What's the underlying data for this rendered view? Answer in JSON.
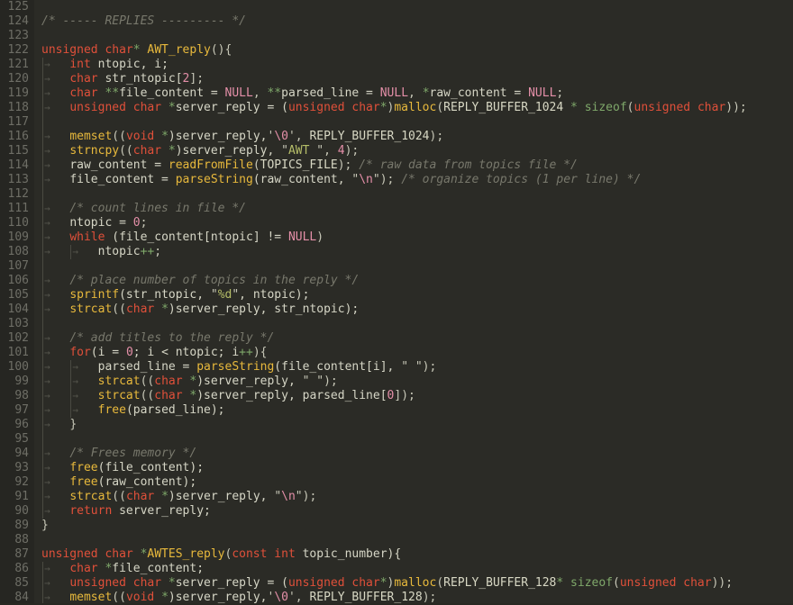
{
  "editor": {
    "name": "code-editor",
    "language": "C",
    "theme": {
      "background": "#2b2b26",
      "gutter_background": "#262622",
      "line_number_color": "#6e6e66",
      "default_text": "#d6d6c6",
      "keyword": "#e0503a",
      "function": "#e8b93c",
      "comment": "#78786c",
      "string": "#b5bd68",
      "number": "#e48fa8",
      "operator": "#7fa86a",
      "indent_guide": "#4a4a42"
    },
    "line_numbering": "relative-descending",
    "first_line_number": "125",
    "last_line_number": "84",
    "total_visible_lines": 42
  },
  "lines": [
    {
      "n": "125",
      "indent": 0,
      "tokens": []
    },
    {
      "n": "124",
      "indent": 0,
      "tokens": [
        {
          "t": "/* ----- REPLIES --------- */",
          "c": "cmt"
        }
      ]
    },
    {
      "n": "123",
      "indent": 0,
      "tokens": []
    },
    {
      "n": "122",
      "indent": 0,
      "tokens": [
        {
          "t": "unsigned char",
          "c": "kw"
        },
        {
          "t": "*",
          "c": "op"
        },
        {
          "t": " ",
          "c": "pun"
        },
        {
          "t": "AWT_reply",
          "c": "fn"
        },
        {
          "t": "(){",
          "c": "pun"
        }
      ]
    },
    {
      "n": "121",
      "indent": 1,
      "tokens": [
        {
          "t": "int",
          "c": "kw"
        },
        {
          "t": " ntopic, i;",
          "c": "id"
        }
      ]
    },
    {
      "n": "120",
      "indent": 1,
      "tokens": [
        {
          "t": "char",
          "c": "kw"
        },
        {
          "t": " str_ntopic[",
          "c": "id"
        },
        {
          "t": "2",
          "c": "num"
        },
        {
          "t": "];",
          "c": "pun"
        }
      ]
    },
    {
      "n": "119",
      "indent": 1,
      "tokens": [
        {
          "t": "char",
          "c": "kw"
        },
        {
          "t": " ",
          "c": "id"
        },
        {
          "t": "**",
          "c": "op"
        },
        {
          "t": "file_content = ",
          "c": "id"
        },
        {
          "t": "NULL",
          "c": "num"
        },
        {
          "t": ", ",
          "c": "pun"
        },
        {
          "t": "**",
          "c": "op"
        },
        {
          "t": "parsed_line = ",
          "c": "id"
        },
        {
          "t": "NULL",
          "c": "num"
        },
        {
          "t": ", ",
          "c": "pun"
        },
        {
          "t": "*",
          "c": "op"
        },
        {
          "t": "raw_content = ",
          "c": "id"
        },
        {
          "t": "NULL",
          "c": "num"
        },
        {
          "t": ";",
          "c": "pun"
        }
      ]
    },
    {
      "n": "118",
      "indent": 1,
      "tokens": [
        {
          "t": "unsigned char",
          "c": "kw"
        },
        {
          "t": " ",
          "c": "id"
        },
        {
          "t": "*",
          "c": "op"
        },
        {
          "t": "server_reply = (",
          "c": "id"
        },
        {
          "t": "unsigned char",
          "c": "kw"
        },
        {
          "t": "*",
          "c": "op"
        },
        {
          "t": ")",
          "c": "pun"
        },
        {
          "t": "malloc",
          "c": "fn"
        },
        {
          "t": "(",
          "c": "pun"
        },
        {
          "t": "REPLY_BUFFER_1024",
          "c": "cst"
        },
        {
          "t": " ",
          "c": "pun"
        },
        {
          "t": "*",
          "c": "op"
        },
        {
          "t": " ",
          "c": "pun"
        },
        {
          "t": "sizeof",
          "c": "op"
        },
        {
          "t": "(",
          "c": "pun"
        },
        {
          "t": "unsigned char",
          "c": "kw"
        },
        {
          "t": "));",
          "c": "pun"
        }
      ]
    },
    {
      "n": "117",
      "indent": 0,
      "tokens": []
    },
    {
      "n": "116",
      "indent": 1,
      "tokens": [
        {
          "t": "memset",
          "c": "fn"
        },
        {
          "t": "((",
          "c": "pun"
        },
        {
          "t": "void",
          "c": "kw"
        },
        {
          "t": " ",
          "c": "id"
        },
        {
          "t": "*",
          "c": "op"
        },
        {
          "t": ")server_reply,",
          "c": "id"
        },
        {
          "t": "'",
          "c": "pun"
        },
        {
          "t": "\\0",
          "c": "num"
        },
        {
          "t": "'",
          "c": "pun"
        },
        {
          "t": ", ",
          "c": "pun"
        },
        {
          "t": "REPLY_BUFFER_1024",
          "c": "cst"
        },
        {
          "t": ");",
          "c": "pun"
        }
      ]
    },
    {
      "n": "115",
      "indent": 1,
      "tokens": [
        {
          "t": "strncpy",
          "c": "fn"
        },
        {
          "t": "((",
          "c": "pun"
        },
        {
          "t": "char",
          "c": "kw"
        },
        {
          "t": " ",
          "c": "id"
        },
        {
          "t": "*",
          "c": "op"
        },
        {
          "t": ")server_reply, ",
          "c": "id"
        },
        {
          "t": "\"",
          "c": "pun"
        },
        {
          "t": "AWT ",
          "c": "str"
        },
        {
          "t": "\"",
          "c": "pun"
        },
        {
          "t": ", ",
          "c": "pun"
        },
        {
          "t": "4",
          "c": "num"
        },
        {
          "t": ");",
          "c": "pun"
        }
      ]
    },
    {
      "n": "114",
      "indent": 1,
      "tokens": [
        {
          "t": "raw_content = ",
          "c": "id"
        },
        {
          "t": "readFromFile",
          "c": "fn"
        },
        {
          "t": "(",
          "c": "pun"
        },
        {
          "t": "TOPICS_FILE",
          "c": "cst"
        },
        {
          "t": "); ",
          "c": "pun"
        },
        {
          "t": "/* raw data from topics file */",
          "c": "cmt"
        }
      ]
    },
    {
      "n": "113",
      "indent": 1,
      "tokens": [
        {
          "t": "file_content = ",
          "c": "id"
        },
        {
          "t": "parseString",
          "c": "fn"
        },
        {
          "t": "(raw_content, ",
          "c": "id"
        },
        {
          "t": "\"",
          "c": "pun"
        },
        {
          "t": "\\n",
          "c": "num"
        },
        {
          "t": "\"",
          "c": "pun"
        },
        {
          "t": "); ",
          "c": "pun"
        },
        {
          "t": "/* organize topics (1 per line) */",
          "c": "cmt"
        }
      ]
    },
    {
      "n": "112",
      "indent": 0,
      "tokens": []
    },
    {
      "n": "111",
      "indent": 1,
      "tokens": [
        {
          "t": "/* count lines in file */",
          "c": "cmt"
        }
      ]
    },
    {
      "n": "110",
      "indent": 1,
      "tokens": [
        {
          "t": "ntopic = ",
          "c": "id"
        },
        {
          "t": "0",
          "c": "num"
        },
        {
          "t": ";",
          "c": "pun"
        }
      ]
    },
    {
      "n": "109",
      "indent": 1,
      "tokens": [
        {
          "t": "while",
          "c": "kw"
        },
        {
          "t": " (file_content[ntopic] != ",
          "c": "id"
        },
        {
          "t": "NULL",
          "c": "num"
        },
        {
          "t": ")",
          "c": "pun"
        }
      ]
    },
    {
      "n": "108",
      "indent": 2,
      "tokens": [
        {
          "t": "ntopic",
          "c": "id"
        },
        {
          "t": "++",
          "c": "op"
        },
        {
          "t": ";",
          "c": "pun"
        }
      ]
    },
    {
      "n": "107",
      "indent": 0,
      "tokens": []
    },
    {
      "n": "106",
      "indent": 1,
      "tokens": [
        {
          "t": "/* place number of topics in the reply */",
          "c": "cmt"
        }
      ]
    },
    {
      "n": "105",
      "indent": 1,
      "tokens": [
        {
          "t": "sprintf",
          "c": "fn"
        },
        {
          "t": "(str_ntopic, ",
          "c": "id"
        },
        {
          "t": "\"",
          "c": "pun"
        },
        {
          "t": "%d",
          "c": "str"
        },
        {
          "t": "\"",
          "c": "pun"
        },
        {
          "t": ", ntopic);",
          "c": "id"
        }
      ]
    },
    {
      "n": "104",
      "indent": 1,
      "tokens": [
        {
          "t": "strcat",
          "c": "fn"
        },
        {
          "t": "((",
          "c": "pun"
        },
        {
          "t": "char",
          "c": "kw"
        },
        {
          "t": " ",
          "c": "id"
        },
        {
          "t": "*",
          "c": "op"
        },
        {
          "t": ")server_reply, str_ntopic);",
          "c": "id"
        }
      ]
    },
    {
      "n": "103",
      "indent": 0,
      "tokens": []
    },
    {
      "n": "102",
      "indent": 1,
      "tokens": [
        {
          "t": "/* add titles to the reply */",
          "c": "cmt"
        }
      ]
    },
    {
      "n": "101",
      "indent": 1,
      "tokens": [
        {
          "t": "for",
          "c": "kw"
        },
        {
          "t": "(i = ",
          "c": "id"
        },
        {
          "t": "0",
          "c": "num"
        },
        {
          "t": "; i < ntopic; i",
          "c": "id"
        },
        {
          "t": "++",
          "c": "op"
        },
        {
          "t": "){",
          "c": "pun"
        }
      ]
    },
    {
      "n": "100",
      "indent": 2,
      "tokens": [
        {
          "t": "parsed_line = ",
          "c": "id"
        },
        {
          "t": "parseString",
          "c": "fn"
        },
        {
          "t": "(file_content[i], ",
          "c": "id"
        },
        {
          "t": "\"",
          "c": "pun"
        },
        {
          "t": " ",
          "c": "str"
        },
        {
          "t": "\"",
          "c": "pun"
        },
        {
          "t": ");",
          "c": "pun"
        }
      ]
    },
    {
      "n": "99",
      "indent": 2,
      "tokens": [
        {
          "t": "strcat",
          "c": "fn"
        },
        {
          "t": "((",
          "c": "pun"
        },
        {
          "t": "char",
          "c": "kw"
        },
        {
          "t": " ",
          "c": "id"
        },
        {
          "t": "*",
          "c": "op"
        },
        {
          "t": ")server_reply, ",
          "c": "id"
        },
        {
          "t": "\"",
          "c": "pun"
        },
        {
          "t": " ",
          "c": "str"
        },
        {
          "t": "\"",
          "c": "pun"
        },
        {
          "t": ");",
          "c": "pun"
        }
      ]
    },
    {
      "n": "98",
      "indent": 2,
      "tokens": [
        {
          "t": "strcat",
          "c": "fn"
        },
        {
          "t": "((",
          "c": "pun"
        },
        {
          "t": "char",
          "c": "kw"
        },
        {
          "t": " ",
          "c": "id"
        },
        {
          "t": "*",
          "c": "op"
        },
        {
          "t": ")server_reply, parsed_line[",
          "c": "id"
        },
        {
          "t": "0",
          "c": "num"
        },
        {
          "t": "]);",
          "c": "pun"
        }
      ]
    },
    {
      "n": "97",
      "indent": 2,
      "tokens": [
        {
          "t": "free",
          "c": "fn"
        },
        {
          "t": "(parsed_line);",
          "c": "id"
        }
      ]
    },
    {
      "n": "96",
      "indent": 1,
      "tokens": [
        {
          "t": "}",
          "c": "pun"
        }
      ]
    },
    {
      "n": "95",
      "indent": 0,
      "tokens": []
    },
    {
      "n": "94",
      "indent": 1,
      "tokens": [
        {
          "t": "/* Frees memory */",
          "c": "cmt"
        }
      ]
    },
    {
      "n": "93",
      "indent": 1,
      "tokens": [
        {
          "t": "free",
          "c": "fn"
        },
        {
          "t": "(file_content);",
          "c": "id"
        }
      ]
    },
    {
      "n": "92",
      "indent": 1,
      "tokens": [
        {
          "t": "free",
          "c": "fn"
        },
        {
          "t": "(raw_content);",
          "c": "id"
        }
      ]
    },
    {
      "n": "91",
      "indent": 1,
      "tokens": [
        {
          "t": "strcat",
          "c": "fn"
        },
        {
          "t": "((",
          "c": "pun"
        },
        {
          "t": "char",
          "c": "kw"
        },
        {
          "t": " ",
          "c": "id"
        },
        {
          "t": "*",
          "c": "op"
        },
        {
          "t": ")server_reply, ",
          "c": "id"
        },
        {
          "t": "\"",
          "c": "pun"
        },
        {
          "t": "\\n",
          "c": "num"
        },
        {
          "t": "\"",
          "c": "pun"
        },
        {
          "t": ");",
          "c": "pun"
        }
      ]
    },
    {
      "n": "90",
      "indent": 1,
      "tokens": [
        {
          "t": "return",
          "c": "kw"
        },
        {
          "t": " server_reply;",
          "c": "id"
        }
      ]
    },
    {
      "n": "89",
      "indent": 0,
      "tokens": [
        {
          "t": "}",
          "c": "pun"
        }
      ]
    },
    {
      "n": "88",
      "indent": 0,
      "tokens": []
    },
    {
      "n": "87",
      "indent": 0,
      "tokens": [
        {
          "t": "unsigned char",
          "c": "kw"
        },
        {
          "t": " ",
          "c": "id"
        },
        {
          "t": "*",
          "c": "op"
        },
        {
          "t": "AWTES_reply",
          "c": "fn"
        },
        {
          "t": "(",
          "c": "pun"
        },
        {
          "t": "const",
          "c": "kw"
        },
        {
          "t": " ",
          "c": "id"
        },
        {
          "t": "int",
          "c": "kw"
        },
        {
          "t": " topic_number){",
          "c": "id"
        }
      ]
    },
    {
      "n": "86",
      "indent": 1,
      "tokens": [
        {
          "t": "char",
          "c": "kw"
        },
        {
          "t": " ",
          "c": "id"
        },
        {
          "t": "*",
          "c": "op"
        },
        {
          "t": "file_content;",
          "c": "id"
        }
      ]
    },
    {
      "n": "85",
      "indent": 1,
      "tokens": [
        {
          "t": "unsigned char",
          "c": "kw"
        },
        {
          "t": " ",
          "c": "id"
        },
        {
          "t": "*",
          "c": "op"
        },
        {
          "t": "server_reply = (",
          "c": "id"
        },
        {
          "t": "unsigned char",
          "c": "kw"
        },
        {
          "t": "*",
          "c": "op"
        },
        {
          "t": ")",
          "c": "pun"
        },
        {
          "t": "malloc",
          "c": "fn"
        },
        {
          "t": "(",
          "c": "pun"
        },
        {
          "t": "REPLY_BUFFER_128",
          "c": "cst"
        },
        {
          "t": "*",
          "c": "op"
        },
        {
          "t": " ",
          "c": "pun"
        },
        {
          "t": "sizeof",
          "c": "op"
        },
        {
          "t": "(",
          "c": "pun"
        },
        {
          "t": "unsigned char",
          "c": "kw"
        },
        {
          "t": "));",
          "c": "pun"
        }
      ]
    },
    {
      "n": "84",
      "indent": 1,
      "tokens": [
        {
          "t": "memset",
          "c": "fn"
        },
        {
          "t": "((",
          "c": "pun"
        },
        {
          "t": "void",
          "c": "kw"
        },
        {
          "t": " ",
          "c": "id"
        },
        {
          "t": "*",
          "c": "op"
        },
        {
          "t": ")server_reply,",
          "c": "id"
        },
        {
          "t": "'",
          "c": "pun"
        },
        {
          "t": "\\0",
          "c": "num"
        },
        {
          "t": "'",
          "c": "pun"
        },
        {
          "t": ", ",
          "c": "pun"
        },
        {
          "t": "REPLY_BUFFER_128",
          "c": "cst"
        },
        {
          "t": ");",
          "c": "pun"
        }
      ]
    }
  ]
}
